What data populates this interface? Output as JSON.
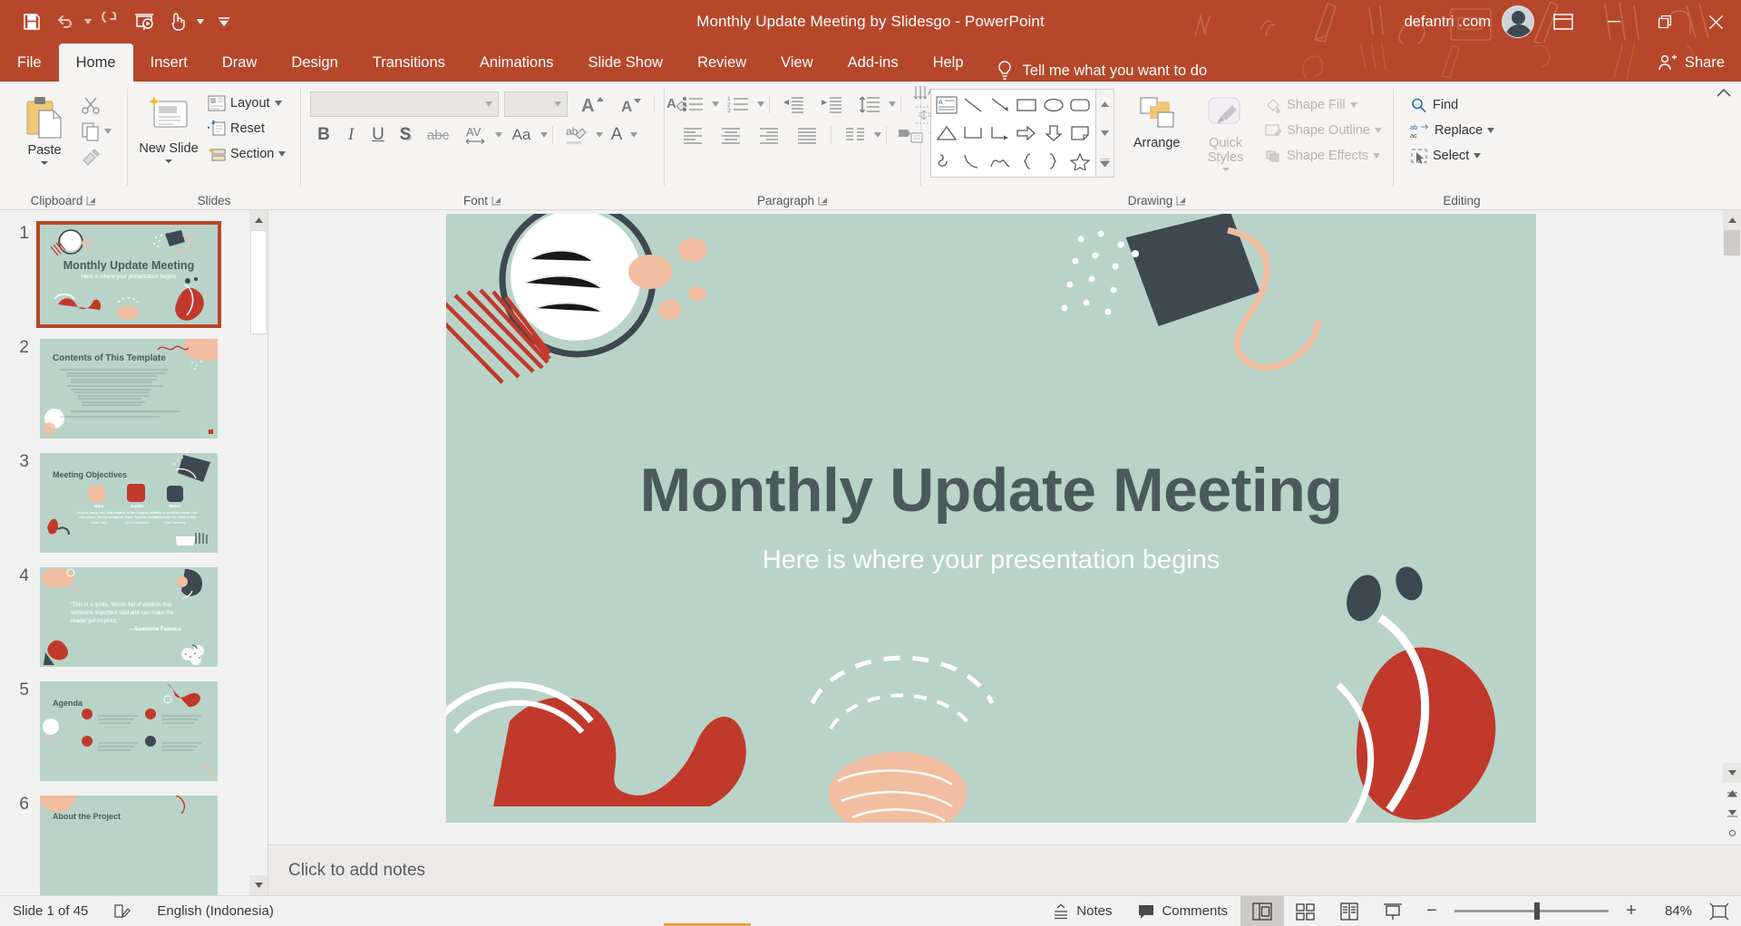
{
  "window": {
    "title": "Monthly Update Meeting by Slidesgo  -  PowerPoint",
    "account_name": "defantri .com",
    "minimize_label": "Minimize",
    "restore_label": "Restore Down",
    "close_label": "Close",
    "ribbon_display_label": "Ribbon Display Options"
  },
  "quick_access": [
    {
      "name": "save-button",
      "icon": "save-icon",
      "label": "Save"
    },
    {
      "name": "undo-button",
      "icon": "undo-icon",
      "label": "Undo",
      "has_caret": true
    },
    {
      "name": "redo-button",
      "icon": "redo-icon",
      "label": "Redo"
    },
    {
      "name": "start-from-beginning-button",
      "icon": "slideshow-icon",
      "label": "Start From Beginning"
    },
    {
      "name": "touch-mouse-mode-button",
      "icon": "touch-mode-icon",
      "label": "Touch/Mouse Mode",
      "has_caret": true
    },
    {
      "name": "customize-quick-access-button",
      "icon": "chevron-down-icon",
      "label": "Customize Quick Access Toolbar"
    }
  ],
  "tabs": [
    {
      "label": "File",
      "active": false
    },
    {
      "label": "Home",
      "active": true
    },
    {
      "label": "Insert",
      "active": false
    },
    {
      "label": "Draw",
      "active": false
    },
    {
      "label": "Design",
      "active": false
    },
    {
      "label": "Transitions",
      "active": false
    },
    {
      "label": "Animations",
      "active": false
    },
    {
      "label": "Slide Show",
      "active": false
    },
    {
      "label": "Review",
      "active": false
    },
    {
      "label": "View",
      "active": false
    },
    {
      "label": "Add-ins",
      "active": false
    },
    {
      "label": "Help",
      "active": false
    }
  ],
  "tell_me": {
    "label": "Tell me what you want to do",
    "icon": "lightbulb-icon"
  },
  "share": {
    "label": "Share",
    "icon": "share-person-icon"
  },
  "ribbon": {
    "groups": [
      {
        "name": "clipboard",
        "label": "Clipboard",
        "has_dialog_launcher": true,
        "paste": {
          "label": "Paste",
          "icon": "clipboard-paste-icon"
        },
        "items": [
          {
            "label": "Cut",
            "icon": "scissors-icon"
          },
          {
            "label": "Copy",
            "icon": "copy-icon"
          },
          {
            "label": "Format Painter",
            "icon": "format-painter-icon"
          }
        ]
      },
      {
        "name": "slides",
        "label": "Slides",
        "has_dialog_launcher": false,
        "new_slide": {
          "label": "New Slide",
          "icon": "new-slide-icon"
        },
        "items": [
          {
            "label": "Layout",
            "icon": "layout-icon",
            "has_caret": true
          },
          {
            "label": "Reset",
            "icon": "reset-icon",
            "has_caret": false
          },
          {
            "label": "Section",
            "icon": "section-icon",
            "has_caret": true
          }
        ]
      },
      {
        "name": "font",
        "label": "Font",
        "has_dialog_launcher": true,
        "font_name_value": "",
        "font_size_value": "",
        "font_name_placeholder": "",
        "font_size_placeholder": "",
        "items": [
          {
            "label": "Increase Font Size",
            "icon": "increase-font-size-icon"
          },
          {
            "label": "Decrease Font Size",
            "icon": "decrease-font-size-icon"
          },
          {
            "label": "Clear All Formatting",
            "icon": "clear-formatting-icon"
          },
          {
            "label": "Bold",
            "icon": "bold-icon",
            "glyph": "B"
          },
          {
            "label": "Italic",
            "icon": "italic-icon",
            "glyph": "I"
          },
          {
            "label": "Underline",
            "icon": "underline-icon",
            "glyph": "U"
          },
          {
            "label": "Text Shadow",
            "icon": "text-shadow-icon",
            "glyph": "S"
          },
          {
            "label": "Strikethrough",
            "icon": "strikethrough-icon",
            "glyph": "abc"
          },
          {
            "label": "Character Spacing",
            "icon": "character-spacing-icon",
            "glyph": "AV"
          },
          {
            "label": "Change Case",
            "icon": "change-case-icon",
            "glyph": "Aa"
          },
          {
            "label": "Text Highlight Color",
            "icon": "text-highlight-icon"
          },
          {
            "label": "Font Color",
            "icon": "font-color-icon",
            "glyph": "A"
          }
        ]
      },
      {
        "name": "paragraph",
        "label": "Paragraph",
        "has_dialog_launcher": true,
        "items": [
          {
            "label": "Bullets",
            "icon": "bullets-icon"
          },
          {
            "label": "Numbering",
            "icon": "numbering-icon"
          },
          {
            "label": "Decrease List Level",
            "icon": "decrease-indent-icon"
          },
          {
            "label": "Increase List Level",
            "icon": "increase-indent-icon"
          },
          {
            "label": "Line Spacing",
            "icon": "line-spacing-icon"
          },
          {
            "label": "Text Direction",
            "icon": "text-direction-icon"
          },
          {
            "label": "Align Text",
            "icon": "align-text-icon"
          },
          {
            "label": "Align Left",
            "icon": "align-left-icon"
          },
          {
            "label": "Center",
            "icon": "align-center-icon"
          },
          {
            "label": "Align Right",
            "icon": "align-right-icon"
          },
          {
            "label": "Justify",
            "icon": "align-justify-icon"
          },
          {
            "label": "Columns",
            "icon": "columns-icon"
          },
          {
            "label": "Convert to SmartArt",
            "icon": "smartart-icon"
          }
        ]
      },
      {
        "name": "drawing",
        "label": "Drawing",
        "has_dialog_launcher": true,
        "arrange": {
          "label": "Arrange",
          "icon": "arrange-icon"
        },
        "quick_styles": {
          "label": "Quick Styles",
          "icon": "quick-styles-icon",
          "disabled": true
        },
        "shape_fill": {
          "label": "Shape Fill",
          "icon": "shape-fill-icon",
          "disabled": true
        },
        "shape_outline": {
          "label": "Shape Outline",
          "icon": "shape-outline-icon",
          "disabled": true
        },
        "shape_effects": {
          "label": "Shape Effects",
          "icon": "shape-effects-icon",
          "disabled": true
        },
        "shapes": [
          "text-box-shape",
          "line-shape",
          "arrow-shape",
          "rectangle-shape",
          "oval-shape",
          "rounded-rectangle-shape",
          "triangle-shape",
          "elbow-connector-shape",
          "elbow-arrow-connector-shape",
          "right-arrow-shape",
          "down-arrow-shape",
          "folded-corner-shape",
          "scribble-shape",
          "arc-shape",
          "curve-shape",
          "left-brace-shape",
          "right-brace-shape",
          "star-shape"
        ]
      },
      {
        "name": "editing",
        "label": "Editing",
        "has_dialog_launcher": false,
        "items": [
          {
            "label": "Find",
            "icon": "search-icon",
            "has_caret": false
          },
          {
            "label": "Replace",
            "icon": "replace-icon",
            "has_caret": true
          },
          {
            "label": "Select",
            "icon": "select-icon",
            "has_caret": true
          }
        ]
      }
    ],
    "collapse_label": "Collapse the Ribbon"
  },
  "thumbnails": [
    {
      "number": "1",
      "title": "Monthly Update Meeting",
      "subtitle": "Here is where your presentation begins",
      "selected": true
    },
    {
      "number": "2",
      "title": "Contents of This Template",
      "subtitle": "",
      "selected": false
    },
    {
      "number": "3",
      "title": "Meeting Objectives",
      "subtitle": "",
      "selected": false
    },
    {
      "number": "4",
      "title": "“This is a quote, Words full of wisdom that someone important said and can make the reader get inspired.”",
      "subtitle": "—Someone Famous",
      "selected": false
    },
    {
      "number": "5",
      "title": "Agenda",
      "subtitle": "",
      "selected": false
    },
    {
      "number": "6",
      "title": "About the Project",
      "subtitle": "",
      "selected": false
    }
  ],
  "thumb3_items": [
    {
      "name": "Mars",
      "desc": "Despite being red, Mars is a cold place. It's full of iron oxide dust"
    },
    {
      "name": "Jupiter",
      "desc": "Jupiter is the biggest planet in our Solar System and the fourth brightest"
    },
    {
      "name": "Venus",
      "desc": "It has a beautiful name, but it's terribly hot, even hotter than Mercury"
    }
  ],
  "slide": {
    "title": "Monthly Update Meeting",
    "subtitle": "Here is where your presentation begins",
    "bg_color": "#b9d3c8",
    "title_color": "#4a5a5a",
    "subtitle_color": "#ffffff",
    "accent_red": "#c1392b",
    "accent_peach": "#f2bda0",
    "accent_dark": "#3d4850"
  },
  "notes": {
    "placeholder": "Click to add notes"
  },
  "status": {
    "slide_counter": "Slide 1 of 45",
    "language": "English (Indonesia)",
    "spellcheck_label": "Spelling and Grammar Check",
    "notes_label": "Notes",
    "comments_label": "Comments",
    "zoom_percent": "84%",
    "zoom_out_label": "Zoom Out",
    "zoom_in_label": "Zoom In",
    "fit_slide_label": "Fit slide to current window",
    "views": [
      {
        "name": "normal-view",
        "label": "Normal",
        "active": true
      },
      {
        "name": "slide-sorter-view",
        "label": "Slide Sorter",
        "active": false
      },
      {
        "name": "reading-view",
        "label": "Reading View",
        "active": false
      },
      {
        "name": "slide-show-view",
        "label": "Slide Show",
        "active": false
      }
    ]
  },
  "colors": {
    "brand_red": "#b7472a",
    "ribbon_bg": "#f5f4f3",
    "app_bg": "#f1f1f1",
    "slide_green": "#b9d3c8"
  }
}
